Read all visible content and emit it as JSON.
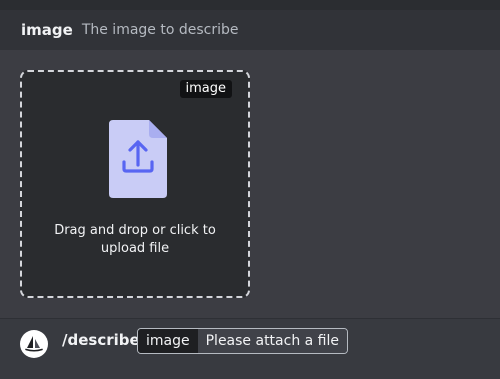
{
  "option_header": {
    "name": "image",
    "description": "The image to describe"
  },
  "dropzone": {
    "tag": "image",
    "line1": "Drag and drop or click to",
    "line2": "upload file",
    "icon": "upload-file-icon"
  },
  "command_bar": {
    "avatar_icon": "bot-sailboat-icon",
    "command": "/describe",
    "field_label": "image",
    "field_value": "Please attach a file"
  },
  "colors": {
    "background": "#2b2d31",
    "panel": "#3c3d43",
    "dropzone": "#2a2c2f",
    "file_icon": "#c9ccf6",
    "file_icon_accent": "#5865f2"
  }
}
